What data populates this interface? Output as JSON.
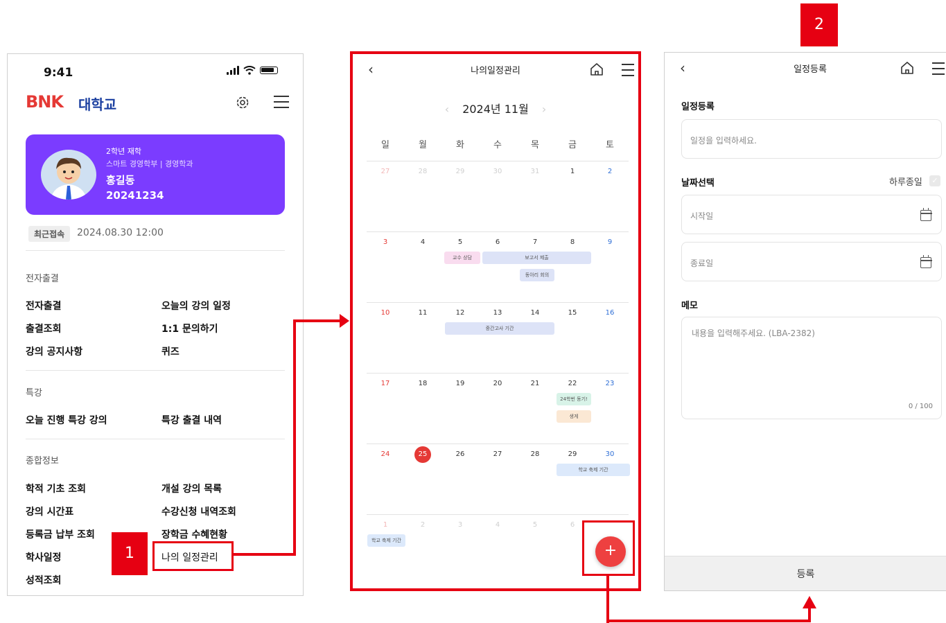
{
  "annotations": {
    "marker1": "1",
    "marker2": "2"
  },
  "screen1": {
    "status_time": "9:41",
    "logo": "BNK",
    "logo_sub": "대학교",
    "profile": {
      "grade": "2학년 재학",
      "department": "스마트 경영학부 | 경영학과",
      "name": "홍길동",
      "student_id": "20241234"
    },
    "recent_label": "최근접속",
    "recent_time": "2024.08.30  12:00",
    "sections": [
      {
        "title": "전자출결",
        "items": [
          "전자출결",
          "오늘의 강의 일정",
          "출결조회",
          "1:1 문의하기",
          "강의 공지사항",
          "퀴즈"
        ]
      },
      {
        "title": "특강",
        "items": [
          "오늘 진행 특강 강의",
          "특강 출결 내역"
        ]
      },
      {
        "title": "종합정보",
        "items": [
          "학적 기초 조회",
          "개설 강의 목록",
          "강의 시간표",
          "수강신청 내역조회",
          "등록금 납부 조회",
          "장학금 수혜현황",
          "학사일정",
          "나의 일정관리",
          "성적조회"
        ]
      }
    ]
  },
  "screen2": {
    "title": "나의일정관리",
    "month": "2024년 11월",
    "weekdays": [
      "일",
      "월",
      "화",
      "수",
      "목",
      "금",
      "토"
    ],
    "weeks": [
      [
        "27",
        "28",
        "29",
        "30",
        "31",
        "1",
        "2"
      ],
      [
        "3",
        "4",
        "5",
        "6",
        "7",
        "8",
        "9"
      ],
      [
        "10",
        "11",
        "12",
        "13",
        "14",
        "15",
        "16"
      ],
      [
        "17",
        "18",
        "19",
        "20",
        "21",
        "22",
        "23"
      ],
      [
        "24",
        "25",
        "26",
        "27",
        "28",
        "29",
        "30"
      ],
      [
        "1",
        "2",
        "3",
        "4",
        "5",
        "6",
        ""
      ]
    ],
    "today": "25",
    "events": {
      "e1": "교수 상담",
      "e2": "보고서 제출",
      "e3": "동아리 회의",
      "e4": "중간고사 기간",
      "e5": "24학번 동기!",
      "e6": "생게",
      "e7": "학교 축제 기간",
      "e8": "학교 축제 기간"
    },
    "fab": "+"
  },
  "screen3": {
    "title": "일정등록",
    "section_schedule": "일정등록",
    "schedule_placeholder": "일정을 입력하세요.",
    "section_date": "날짜선택",
    "allday_label": "하루종일",
    "start_placeholder": "시작일",
    "end_placeholder": "종료일",
    "section_memo": "메모",
    "memo_placeholder": "내용을 입력해주세요. (LBA-2382)",
    "memo_counter": "0 / 100",
    "submit_label": "등록"
  },
  "colors": {
    "accent_red": "#e60012",
    "profile_purple": "#7b3cff",
    "today_red": "#e53935",
    "saturday_blue": "#2f6fd6"
  }
}
